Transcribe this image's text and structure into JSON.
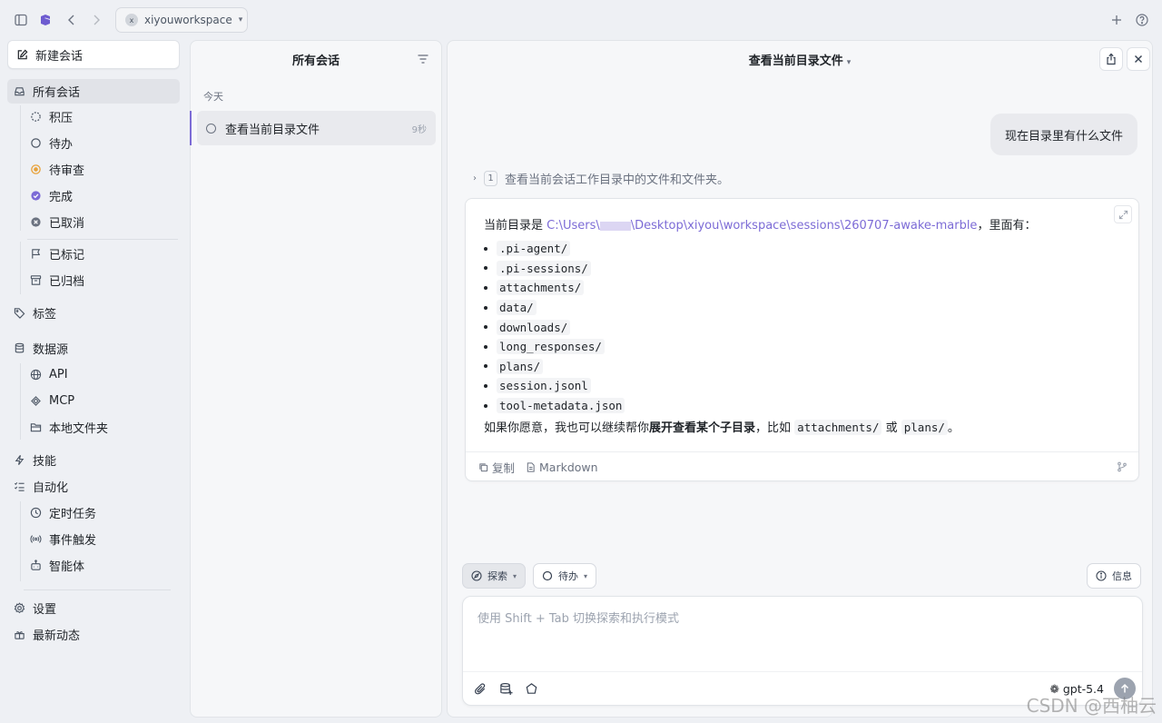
{
  "titlebar": {
    "workspace_badge": "x",
    "workspace_name": "xiyouworkspace"
  },
  "sidebar": {
    "new_chat": "新建会话",
    "all_chats": "所有会话",
    "status_items": [
      {
        "label": "积压",
        "icon": "backlog-icon"
      },
      {
        "label": "待办",
        "icon": "todo-icon"
      },
      {
        "label": "待审查",
        "icon": "review-icon",
        "color": "#e8a23a"
      },
      {
        "label": "完成",
        "icon": "done-icon",
        "color": "#7c6bd6"
      },
      {
        "label": "已取消",
        "icon": "cancelled-icon"
      }
    ],
    "flagged": "已标记",
    "archived": "已归档",
    "tags": "标签",
    "sources": "数据源",
    "source_items": [
      "API",
      "MCP",
      "本地文件夹"
    ],
    "skills": "技能",
    "automation": "自动化",
    "automation_items": [
      "定时任务",
      "事件触发",
      "智能体"
    ],
    "settings": "设置",
    "whats_new": "最新动态"
  },
  "list": {
    "title": "所有会话",
    "group_today": "今天",
    "conversation": {
      "title": "查看当前目录文件",
      "time": "9秒"
    }
  },
  "main": {
    "title": "查看当前目录文件",
    "user_message": "现在目录里有什么文件",
    "tool": {
      "count": "1",
      "summary": "查看当前会话工作目录中的文件和文件夹。"
    },
    "answer": {
      "intro_prefix": "当前目录是 ",
      "path_start": "C:\\Users\\",
      "path_end": "\\Desktop\\xiyou\\workspace\\sessions\\260707-awake-marble",
      "intro_suffix": "，里面有：",
      "files": [
        ".pi-agent/",
        ".pi-sessions/",
        "attachments/",
        "data/",
        "downloads/",
        "long_responses/",
        "plans/",
        "session.jsonl",
        "tool-metadata.json"
      ],
      "outro_prefix": "如果你愿意，我也可以继续帮你",
      "outro_bold": "展开查看某个子目录",
      "outro_mid": "，比如 ",
      "outro_code1": "attachments/",
      "outro_or": " 或 ",
      "outro_code2": "plans/",
      "outro_end": "。"
    },
    "footer": {
      "copy": "复制",
      "markdown": "Markdown"
    }
  },
  "composer": {
    "mode": "探索",
    "status": "待办",
    "info": "信息",
    "placeholder": "使用 Shift + Tab 切换探索和执行模式",
    "model": "gpt-5.4"
  },
  "watermark": "CSDN @西柚云"
}
